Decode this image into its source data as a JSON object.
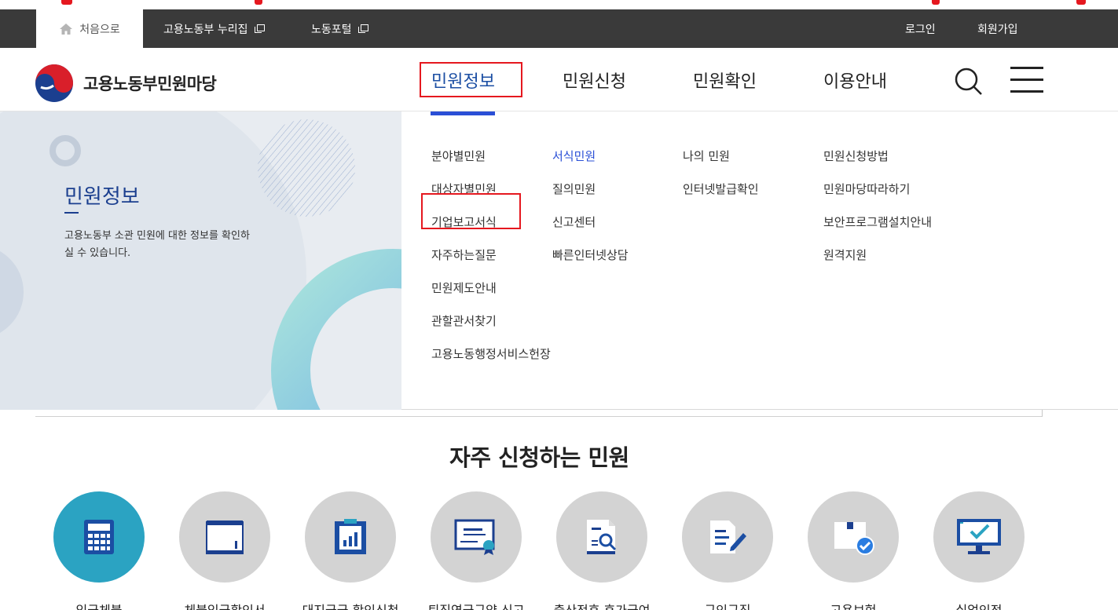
{
  "utility": {
    "home_label": "처음으로",
    "nurijip_label": "고용노동부 누리집",
    "portal_label": "노동포털",
    "login_label": "로그인",
    "join_label": "회원가입"
  },
  "header": {
    "logo_text": "고용노동부민원마당",
    "nav": [
      "민원정보",
      "민원신청",
      "민원확인",
      "이용안내"
    ],
    "active_nav": "민원정보"
  },
  "mega": {
    "title": "민원정보",
    "description": "고용노동부 소관 민원에 대한 정보를 확인하실 수 있습니다.",
    "columns": [
      [
        "분야별민원",
        "대상자별민원",
        "기업보고서식",
        "자주하는질문",
        "민원제도안내",
        "관할관서찾기",
        "고용노동행정서비스헌장"
      ],
      [
        "서식민원",
        "질의민원",
        "신고센터",
        "빠른인터넷상담"
      ],
      [
        "나의 민원",
        "인터넷발급확인"
      ],
      [
        "민원신청방법",
        "민원마당따라하기",
        "보안프로그램설치안내",
        "원격지원"
      ]
    ],
    "active_link": "서식민원"
  },
  "frequent": {
    "title": "자주 신청하는 민원",
    "items": [
      {
        "label": "임금체불",
        "icon": "calculator-icon"
      },
      {
        "label": "체불임금확인서",
        "icon": "document-icon"
      },
      {
        "label": "대지급금 확인신청",
        "icon": "chart-document-icon"
      },
      {
        "label": "퇴직연금규약 신고",
        "icon": "certificate-icon"
      },
      {
        "label": "출산전후 휴가급여",
        "icon": "document-search-icon"
      },
      {
        "label": "구인구직",
        "icon": "edit-document-icon"
      },
      {
        "label": "고용보험",
        "icon": "box-check-icon"
      },
      {
        "label": "실업인정",
        "icon": "monitor-check-icon"
      }
    ]
  },
  "colors": {
    "primary": "#1b4ea3",
    "accent_blue": "#2a4fd6",
    "highlight_red": "#e5181f",
    "util_bar": "#3a3a3a",
    "active_circle": "#2ba3c2"
  }
}
